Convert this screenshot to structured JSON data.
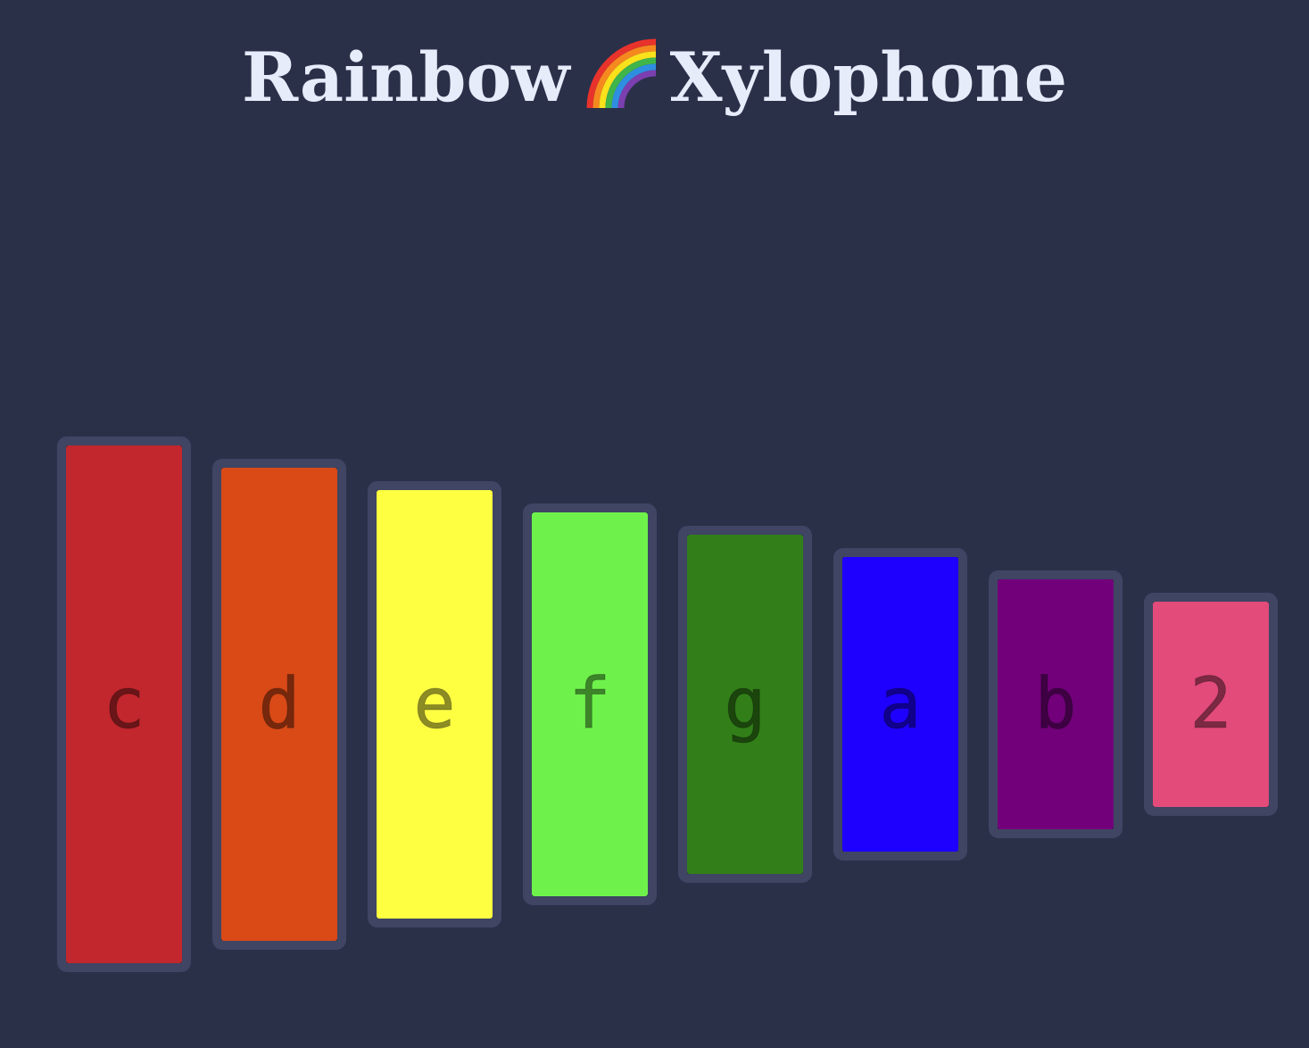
{
  "header": {
    "title_part1": "Rainbow",
    "title_emoji": "rainbow-icon",
    "title_part2": "Xylophone"
  },
  "colors": {
    "background": "#2b3049",
    "bar_border": "#3f4563",
    "title": "#e6ecfa"
  },
  "keys": [
    {
      "label": "c",
      "color": "#c1272d"
    },
    {
      "label": "d",
      "color": "#d94a17"
    },
    {
      "label": "e",
      "color": "#ffff42"
    },
    {
      "label": "f",
      "color": "#6ef24b"
    },
    {
      "label": "g",
      "color": "#327f19"
    },
    {
      "label": "a",
      "color": "#1e00ff"
    },
    {
      "label": "b",
      "color": "#72007a"
    },
    {
      "label": "2",
      "color": "#e24b7a"
    }
  ]
}
